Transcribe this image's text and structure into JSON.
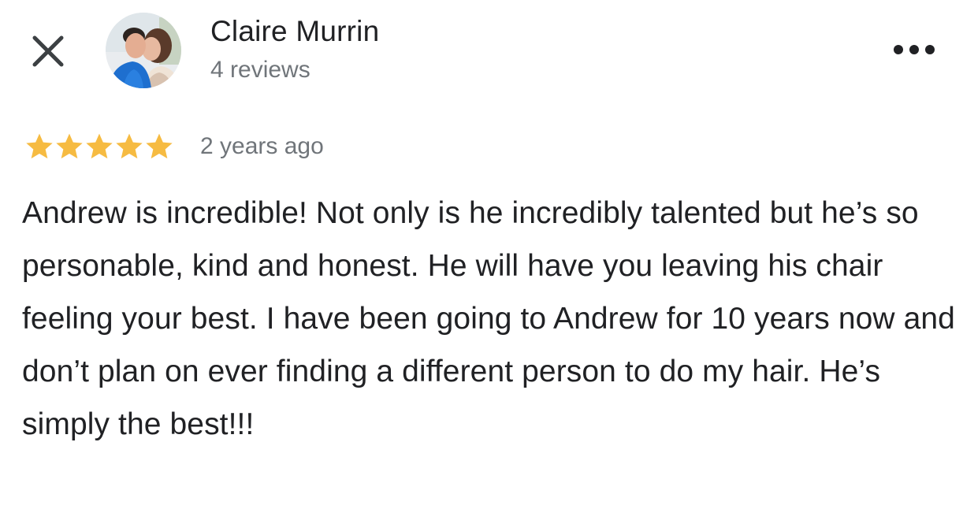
{
  "header": {
    "close_icon": "close-icon",
    "more_icon": "more-options-icon"
  },
  "reviewer": {
    "name": "Claire Murrin",
    "review_count": "4 reviews",
    "avatar": "profile-photo"
  },
  "review": {
    "rating": 5,
    "rating_max": 5,
    "star_color": "#f6bb42",
    "date": "2 years ago",
    "text": "Andrew is incredible! Not only is he incredibly talented but he’s so personable, kind and honest. He will have you leaving his chair feeling your best. I have been going to Andrew for 10 years now and don’t plan on ever finding a different person to do my hair. He’s simply the best!!!"
  }
}
